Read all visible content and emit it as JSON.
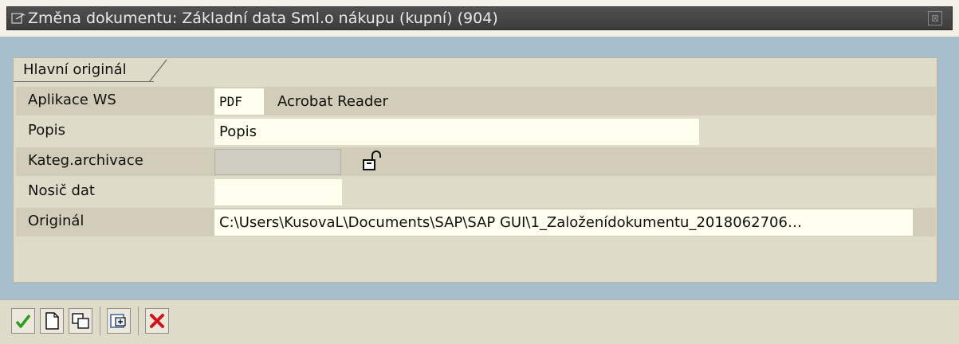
{
  "window": {
    "title": "Změna dokumentu: Základní data Sml.o nákupu (kupní) (904)",
    "close_symbol": "⊠"
  },
  "tab": {
    "label": "Hlavní originál"
  },
  "fields": {
    "application": {
      "label": "Aplikace WS",
      "code": "PDF",
      "description": "Acrobat Reader"
    },
    "description": {
      "label": "Popis",
      "value": "Popis"
    },
    "archive_category": {
      "label": "Kateg.archivace",
      "value": ""
    },
    "data_carrier": {
      "label": "Nosič dat",
      "value": ""
    },
    "original": {
      "label": "Originál",
      "value": "C:\\Users\\KusovaL\\Documents\\SAP\\SAP GUI\\1_Založenídokumentu_2018062706…"
    }
  },
  "icons": {
    "title": "document-edit-icon",
    "lock": "open-lock-icon",
    "toolbar": [
      "confirm-check-icon",
      "new-document-icon",
      "copy-icon",
      "insert-icon",
      "cancel-icon"
    ]
  },
  "colors": {
    "titlebar": "#454545",
    "background": "#dfdbc9",
    "content_area": "#a7bfcd",
    "field_bg": "#fffff0",
    "field_disabled": "#cfccc1",
    "confirm": "#2f9b1f",
    "cancel": "#d0121b"
  }
}
